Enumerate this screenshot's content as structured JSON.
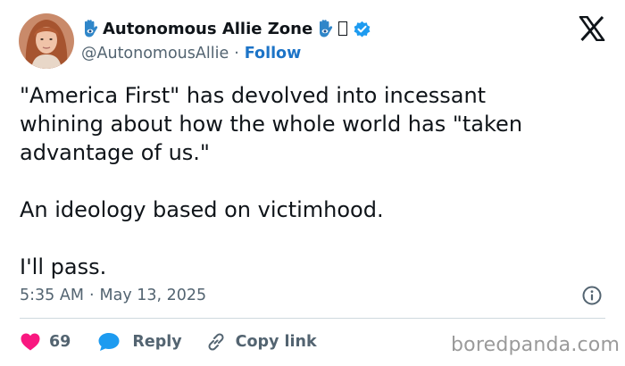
{
  "author": {
    "display_name": "Autonomous Allie Zone",
    "handle": "@AutonomousAllie",
    "follow_label": "Follow",
    "name_icons": [
      "hamsa-emoji",
      "hamsa-emoji",
      "missing-glyph",
      "verified-badge"
    ],
    "avatar": "profile-photo"
  },
  "tweet": {
    "paragraphs": [
      [
        "\"America First\" has devolved into incessant",
        "whining about how the whole world has \"taken",
        "advantage of us.\""
      ],
      [
        "An ideology based on victimhood."
      ],
      [
        "I'll pass."
      ]
    ],
    "time": "5:35 AM",
    "date": "May 13, 2025"
  },
  "actions": {
    "like_count": "69",
    "reply_label": "Reply",
    "copy_link_label": "Copy link"
  },
  "watermark": "boredpanda.com",
  "colors": {
    "text": "#0f1419",
    "secondary": "#536471",
    "link": "#1d74c7",
    "like": "#f91880",
    "reply": "#1d9bf0",
    "verified": "#1d9bf0",
    "divider": "#cfd9de",
    "watermark": "#9a9a9a"
  }
}
